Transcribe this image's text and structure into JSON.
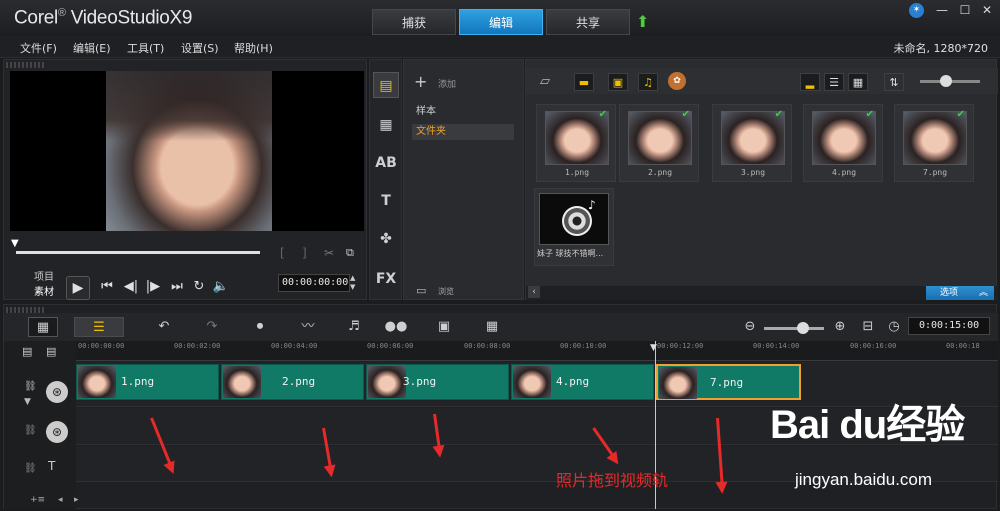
{
  "app": {
    "brand": "Corel",
    "product": "VideoStudio",
    "version": "X9"
  },
  "tabs": [
    {
      "label": "捕获"
    },
    {
      "label": "编辑"
    },
    {
      "label": "共享"
    }
  ],
  "menu": [
    "文件(F)",
    "编辑(E)",
    "工具(T)",
    "设置(S)",
    "帮助(H)"
  ],
  "project_info": "未命名, 1280*720",
  "player": {
    "mode_project": "项目",
    "mode_clip": "素材",
    "timecode": "00:00:00:00",
    "trim_marks": [
      "[",
      "]"
    ]
  },
  "library": {
    "add_label": "添加",
    "folders": [
      "样本",
      "文件夹"
    ],
    "selected_folder": "文件夹",
    "browse_label": "浏览",
    "options_label": "选项",
    "items": [
      {
        "name": "1.png",
        "checked": true
      },
      {
        "name": "2.png",
        "checked": true
      },
      {
        "name": "3.png",
        "checked": true
      },
      {
        "name": "4.png",
        "checked": true
      },
      {
        "name": "7.png",
        "checked": true
      }
    ],
    "music_item": {
      "name": "妹子 球技不错啊..."
    }
  },
  "timeline": {
    "duration": "0:00:15:00",
    "ruler": [
      "00:00:00:00",
      "00:00:02:00",
      "00:00:04:00",
      "00:00:06:00",
      "00:00:08:00",
      "00:00:10:00",
      "00:00:12:00",
      "00:00:14:00",
      "00:00:16:00",
      "00:00:18"
    ],
    "clips": [
      {
        "name": "1.png"
      },
      {
        "name": "2.png"
      },
      {
        "name": "3.png"
      },
      {
        "name": "4.png"
      },
      {
        "name": "7.png",
        "selected": true
      }
    ]
  },
  "annotation": "照片拖到视频轨",
  "watermark": {
    "brand": "Bai du经验",
    "url": "jingyan.baidu.com"
  },
  "colors": {
    "active_tab": "#1c86cf",
    "clip": "#117a66",
    "selection": "#f0a030",
    "annotation": "#e52a2a"
  }
}
